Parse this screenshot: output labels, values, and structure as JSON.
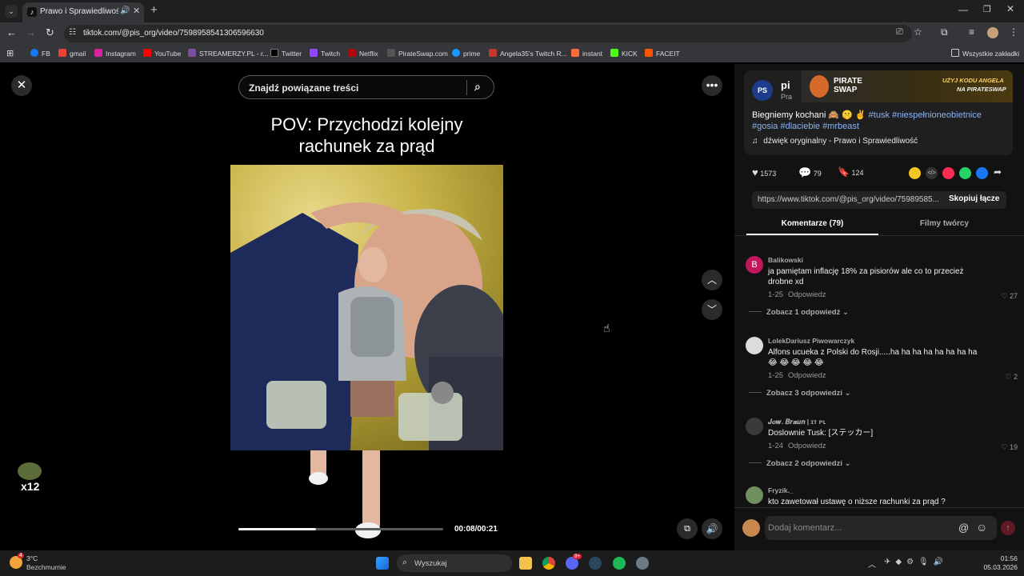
{
  "browser": {
    "tab_title": "Prawo i Sprawiedliwość (@...",
    "url": "tiktok.com/@pis_org/video/7598958541306596630",
    "bookmarks": [
      "FB",
      "gmail",
      "Instagram",
      "YouTube",
      "STREAMERZY.PL - r...",
      "Twitter",
      "Twitch",
      "Netflix",
      "PirateSwap.com",
      "prime",
      "Angela35's Twitch R...",
      "instant",
      "KICK",
      "FACEIT"
    ],
    "all_bookmarks": "Wszystkie zakładki"
  },
  "video": {
    "search_placeholder": "Znajdź powiązane treści",
    "caption_line1": "POV: Przychodzi kolejny",
    "caption_line2": "rachunek za prąd",
    "time": "00:08/00:21",
    "progress": 0.38,
    "gif_badge": "x12"
  },
  "post": {
    "author_short": "pi",
    "author_sub": "Pra",
    "badge": "PS",
    "promo_title": "PIRATE SWAP",
    "promo_line1": "UŻYJ KODU ANGELA",
    "promo_line2": "NA PIRATESWAP",
    "description": "Biegniemy kochani 🙈 🤫 ✌️",
    "hashtags_line1": "#tusk #niespełnioneobietnice",
    "hashtags_line2": "#gosia #dlaciebie #mrbeast",
    "sound": "dźwięk oryginalny - Prawo i Sprawiedliwość",
    "likes": "1573",
    "comments": "79",
    "saves": "124",
    "link": "https://www.tiktok.com/@pis_org/video/75989585...",
    "copy_link": "Skopiuj łącze",
    "tab_comments": "Komentarze (79)",
    "tab_creator": "Filmy twórcy",
    "add_comment_placeholder": "Dodaj komentarz..."
  },
  "comments": [
    {
      "user": "Balikowski",
      "initial": "B",
      "text": "ja pamiętam inflację 18% za pisiorów ale co to przecież drobne xd",
      "date": "1-25",
      "reply": "Odpowiedz",
      "likes": "27",
      "view_replies": "Zobacz 1 odpowiedź"
    },
    {
      "user": "LolekDariusz Piwowarczyk",
      "text": "Alfons ucueka z Polski do Rosji.....ha ha ha ha ha ha ha ha 😂 😂 😂 😂 😂",
      "date": "1-25",
      "reply": "Odpowiedz",
      "likes": "2",
      "view_replies": "Zobacz 3 odpowiedzi"
    },
    {
      "user": "𝑱𝒐𝒘. 𝑩𝒓𝒂𝒖𝒏 | ɪᴛ ᴘʟ",
      "text": "Doslownie Tusk: [ステッカー]",
      "date": "1-24",
      "reply": "Odpowiedz",
      "likes": "19",
      "view_replies": "Zobacz 2 odpowiedzi"
    },
    {
      "user": "Fryzik._",
      "text": "kto zawetował ustawę o niższe rachunki za prąd ?"
    }
  ],
  "taskbar": {
    "weather_temp": "3°C",
    "weather_desc": "Bezchmurnie",
    "search": "Wyszukaj",
    "time": "01:56",
    "date": "05.03.2026",
    "discord_badge": "9+",
    "weather_badge": "4"
  },
  "colors": {
    "accent": "#fe2c55",
    "hashtag": "#8ab4f8",
    "panel": "#121212"
  }
}
